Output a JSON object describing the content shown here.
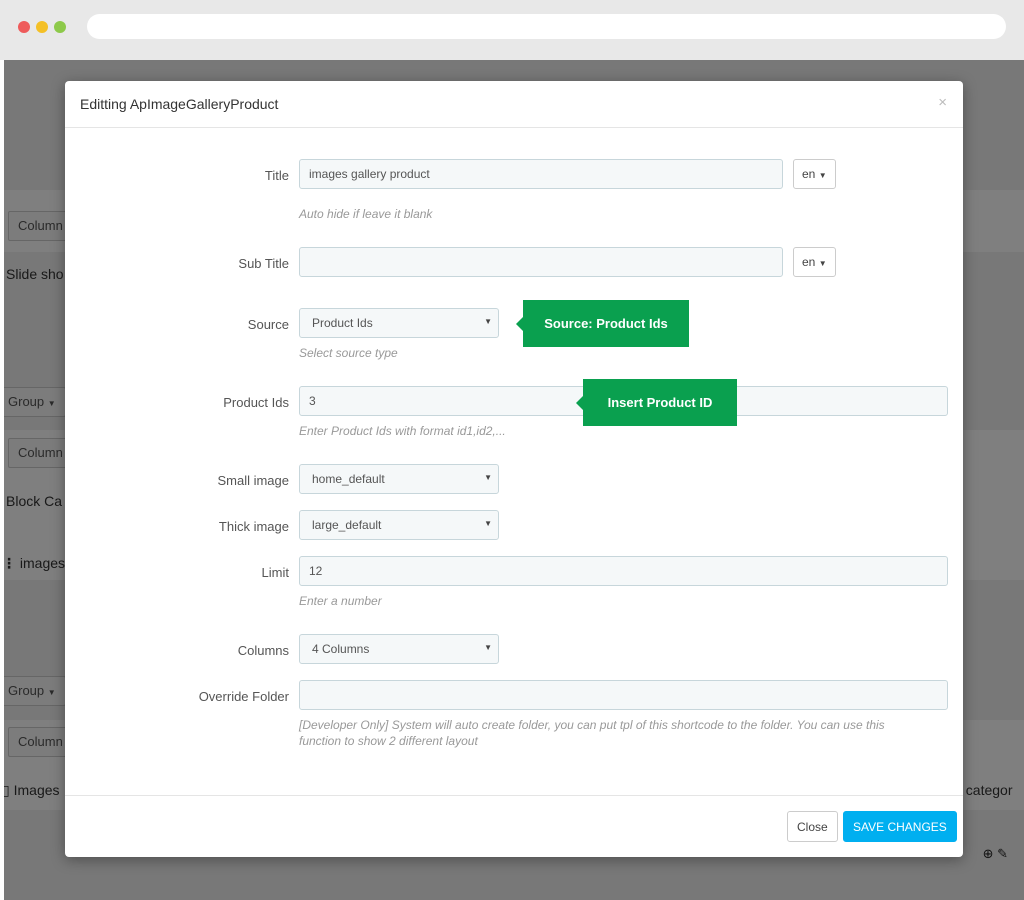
{
  "background": {
    "buttons": [
      "Column",
      "Group",
      "Column",
      "Group",
      "Column"
    ],
    "texts": [
      "Slide sho",
      "Block Ca",
      "images",
      "Images",
      "f categor"
    ]
  },
  "modal": {
    "title": "Editting ApImageGalleryProduct",
    "close_icon": "×",
    "fields": {
      "title": {
        "label": "Title",
        "value": "images gallery product",
        "lang": "en",
        "help": "Auto hide if leave it blank"
      },
      "subtitle": {
        "label": "Sub Title",
        "value": "",
        "lang": "en"
      },
      "source": {
        "label": "Source",
        "value": "Product Ids",
        "help": "Select source type"
      },
      "product_ids": {
        "label": "Product Ids",
        "value": "3",
        "help": "Enter Product Ids with format id1,id2,..."
      },
      "small_image": {
        "label": "Small image",
        "value": "home_default"
      },
      "thick_image": {
        "label": "Thick image",
        "value": "large_default"
      },
      "limit": {
        "label": "Limit",
        "value": "12",
        "help": "Enter a number"
      },
      "columns": {
        "label": "Columns",
        "value": "4 Columns"
      },
      "override_folder": {
        "label": "Override Folder",
        "value": "",
        "help_line1": "[Developer Only] System will auto create folder, you can put tpl of this shortcode to the folder. You can use this",
        "help_line2": "function to show 2 different layout"
      }
    },
    "tooltips": {
      "source": "Source: Product Ids",
      "product_ids": "Insert Product ID"
    },
    "footer": {
      "close_label": "Close",
      "save_label": "SAVE CHANGES"
    }
  },
  "colors": {
    "tooltip": "#0aa04f",
    "save_button": "#00aff0"
  }
}
